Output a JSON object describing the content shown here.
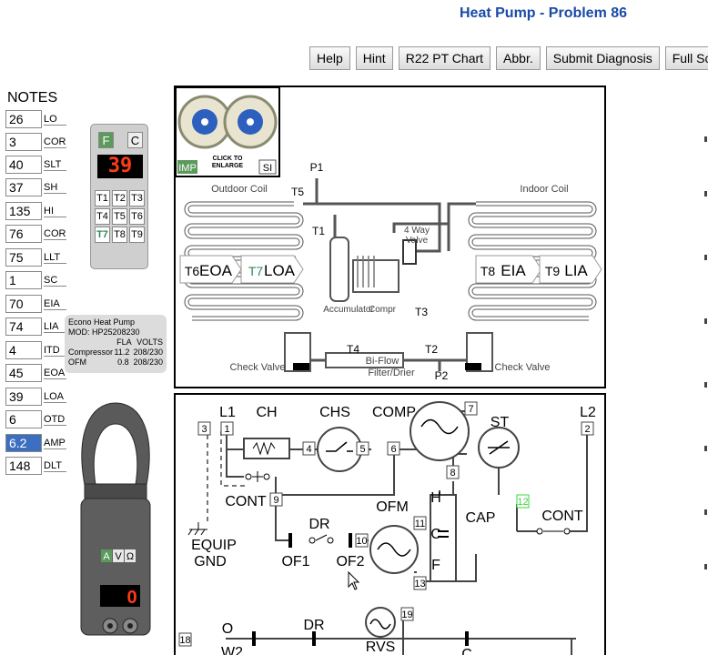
{
  "title": "Heat Pump - Problem 86",
  "toolbar": {
    "buttons": [
      "Help",
      "Hint",
      "R22 PT Chart",
      "Abbr.",
      "Submit Diagnosis",
      "Full Scree"
    ]
  },
  "notes": {
    "title": "NOTES",
    "rows": [
      {
        "value": "26",
        "label": "LO"
      },
      {
        "value": "3",
        "label": "COR"
      },
      {
        "value": "40",
        "label": "SLT"
      },
      {
        "value": "37",
        "label": "SH"
      },
      {
        "value": "135",
        "label": "HI"
      },
      {
        "value": "76",
        "label": "COR"
      },
      {
        "value": "75",
        "label": "LLT"
      },
      {
        "value": "1",
        "label": "SC"
      },
      {
        "value": "70",
        "label": "EIA"
      },
      {
        "value": "74",
        "label": "LIA"
      },
      {
        "value": "4",
        "label": "ITD"
      },
      {
        "value": "45",
        "label": "EOA"
      },
      {
        "value": "39",
        "label": "LOA"
      },
      {
        "value": "6",
        "label": "OTD"
      },
      {
        "value": "6.2",
        "label": "AMP"
      },
      {
        "value": "148",
        "label": "DLT"
      }
    ]
  },
  "thermometer": {
    "f_label": "F",
    "c_label": "C",
    "reading": "39",
    "buttons": [
      "T1",
      "T2",
      "T3",
      "T4",
      "T5",
      "T6",
      "T7",
      "T8",
      "T9"
    ],
    "selected": "T7"
  },
  "unit_info": {
    "name": "Econo Heat Pump",
    "model": "MOD:  HP25208230",
    "col_fla": "FLA",
    "col_volts": "VOLTS",
    "compressor_label": "Compressor",
    "compressor_fla": "11.2",
    "compressor_volts": "208/230",
    "ofm_label": "OFM",
    "ofm_fla": "0.8",
    "ofm_volts": "208/230"
  },
  "meter": {
    "modes": [
      "A",
      "V",
      "Ω"
    ],
    "selected_mode": "A",
    "reading": "0"
  },
  "gauges": {
    "click_label_1": "CLICK TO",
    "click_label_2": "ENLARGE",
    "imp_label": "IMP",
    "si_label": "SI"
  },
  "refrigerant_diagram": {
    "labels": {
      "p1": "P1",
      "t5": "T5",
      "outdoor_coil": "Outdoor Coil",
      "indoor_coil": "Indoor Coil",
      "t1": "T1",
      "four_way_1": "4 Way",
      "four_way_2": "Valve",
      "t6": "T6",
      "eoa": "EOA",
      "t7": "T7",
      "loa": "LOA",
      "t8": "T8",
      "eia": "EIA",
      "t9": "T9",
      "lia": "LIA",
      "accumulator": "Accumulator",
      "compr": "Compr",
      "t3": "T3",
      "t4": "T4",
      "t2": "T2",
      "biflow": "Bi-Flow",
      "filter": "Filter/Drier",
      "p2": "P2",
      "check_valve_l": "Check Valve",
      "check_valve_r": "Check Valve"
    }
  },
  "wiring_diagram": {
    "labels": {
      "l1": "L1",
      "ch": "CH",
      "chs": "CHS",
      "comp": "COMP",
      "l2": "L2",
      "st": "ST",
      "cont_l": "CONT",
      "cont_r": "CONT",
      "equip": "EQUIP",
      "gnd": "GND",
      "dr": "DR",
      "ofm": "OFM",
      "of1": "OF1",
      "of2": "OF2",
      "h": "H",
      "c": "C",
      "f": "F",
      "cap": "CAP",
      "o": "O",
      "w2": "W2",
      "dr2": "DR",
      "rvs": "RVS",
      "c2": "C"
    },
    "terminals": [
      "3",
      "1",
      "4",
      "5",
      "6",
      "7",
      "2",
      "8",
      "9",
      "10",
      "11",
      "12",
      "13",
      "18",
      "19"
    ]
  },
  "colors": {
    "title": "#1a4aa8",
    "led_red": "#ff3b1a",
    "led_green": "#39d839",
    "selected_green": "#5c9a5c",
    "highlight_blue": "#3d6fc0"
  }
}
